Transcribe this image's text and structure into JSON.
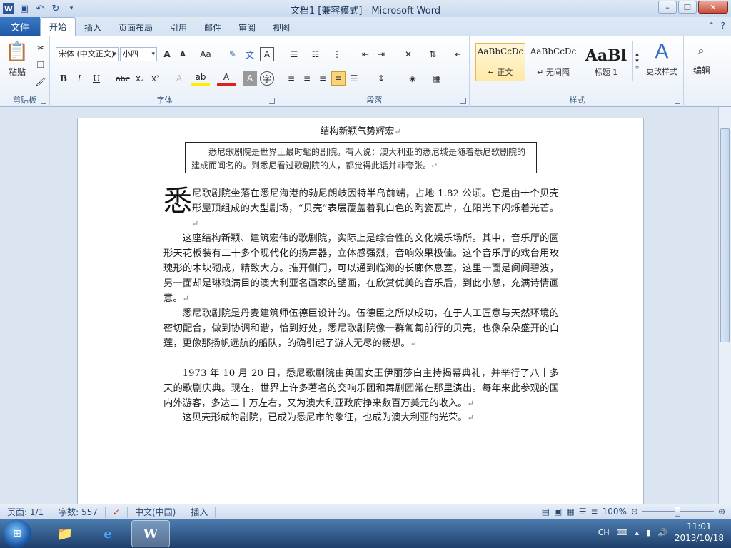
{
  "window": {
    "title": "文档1 [兼容模式] - Microsoft Word"
  },
  "tabs": {
    "file": "文件",
    "items": [
      "开始",
      "插入",
      "页面布局",
      "引用",
      "邮件",
      "审阅",
      "视图"
    ]
  },
  "ribbon": {
    "clipboard": {
      "label": "剪贴板",
      "paste": "粘贴"
    },
    "font": {
      "label": "字体",
      "font_name": "宋体 (中文正文)",
      "font_size": "小四",
      "grow": "A",
      "shrink": "A",
      "case": "Aa",
      "bold": "B",
      "italic": "I",
      "underline": "U",
      "strike": "abc",
      "sub": "x₂",
      "sup": "x²"
    },
    "paragraph": {
      "label": "段落"
    },
    "styles": {
      "label": "样式",
      "items": [
        {
          "sample": "AaBbCcDc",
          "name": "↵ 正文"
        },
        {
          "sample": "AaBbCcDc",
          "name": "↵ 无间隔"
        },
        {
          "sample": "AaBl",
          "name": "标题 1"
        }
      ],
      "change": "更改样式"
    },
    "editing": {
      "label": "编辑"
    }
  },
  "document": {
    "heading": "结构新颖气势辉宏",
    "intro": "悉尼歌剧院是世界上最时髦的剧院。有人说：澳大利亚的悉尼城是随着悉尼歌剧院的建成而闻名的。到悉尼看过歌剧院的人，都觉得此话并非夸张。",
    "dropcap": "悉",
    "paragraphs": [
      "尼歌剧院坐落在悉尼海港的勃尼朗岐因特半岛前端，占地 1.82 公顷。它是由十个贝壳形屋顶组成的大型剧场，“贝壳”表层覆盖着乳白色的陶瓷瓦片，在阳光下闪烁着光芒。",
      "这座结构新颖、建筑宏伟的歌剧院，实际上是综合性的文化娱乐场所。其中，音乐厅的圆形天花板装有二十多个现代化的扬声器，立体感强烈，音响效果极佳。这个音乐厅的戏台用玫瑰形的木块砌成，精致大方。推开侧门，可以通到临海的长廊休息室，这里一面是阆阆碧波，另一面却是琳琅满目的澳大利亚名画家的壁画，在欣赏优美的音乐后，到此小憩，充满诗情画意。",
      "悉尼歌剧院是丹麦建筑师伍德臣设计的。伍德臣之所以成功，在于人工匠意与天然环境的密切配合，做到协调和谐，恰到好处，悉尼歌剧院像一群匍匐前行的贝壳，也像朵朵盛开的白莲，更像那扬帆远航的船队，的确引起了游人无尽的畅想。",
      "1973 年 10 月 20 日，悉尼歌剧院由英国女王伊丽莎白主持揭幕典礼，并举行了八十多天的歌剧庆典。现在，世界上许多著名的交响乐团和舞剧团常在那里演出。每年来此参观的国内外游客，多达二十万左右，又为澳大利亚政府挣来数百万美元的收入。",
      "这贝壳形成的剧院，已成为悉尼市的象征，也成为澳大利亚的光荣。"
    ]
  },
  "statusbar": {
    "page": "页面: 1/1",
    "words": "字数: 557",
    "language": "中文(中国)",
    "mode": "插入",
    "zoom": "100%",
    "zoom_level_percent": 100
  },
  "taskbar": {
    "ime": "CH",
    "time": "11:01",
    "date": "2013/10/18"
  }
}
